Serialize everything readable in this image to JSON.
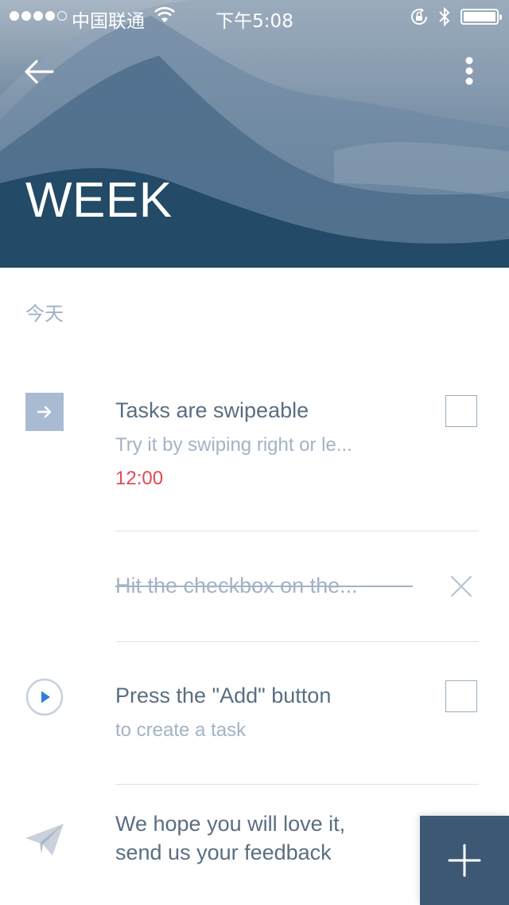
{
  "status_bar": {
    "carrier": "中国联通",
    "time": "下午5:08",
    "signal_bars_filled": 4,
    "signal_bars_total": 5
  },
  "header": {
    "title": "WEEK",
    "back_icon": "arrow-left-icon",
    "menu_icon": "more-vertical-icon"
  },
  "section": {
    "label": "今天"
  },
  "tasks": [
    {
      "title": "Tasks are swipeable",
      "subtitle": "Try it by swiping right or le...",
      "time": "12:00",
      "icon": "arrow-right-box-icon",
      "completed": false
    },
    {
      "title": "Hit the checkbox on the...",
      "completed": true
    },
    {
      "title": "Press the \"Add\" button",
      "subtitle": "to create a task",
      "icon": "play-circle-icon",
      "completed": false
    },
    {
      "title_line1": "We hope you will love it,",
      "title_line2": "send us your feedback",
      "icon": "paper-plane-icon"
    }
  ],
  "fab": {
    "icon": "plus-icon"
  },
  "colors": {
    "accent_dark": "#3d5875",
    "title_text": "#5a6e82",
    "muted_text": "#a3b3c5",
    "time_red": "#e14a55",
    "icon_box": "#a9bbd3"
  }
}
